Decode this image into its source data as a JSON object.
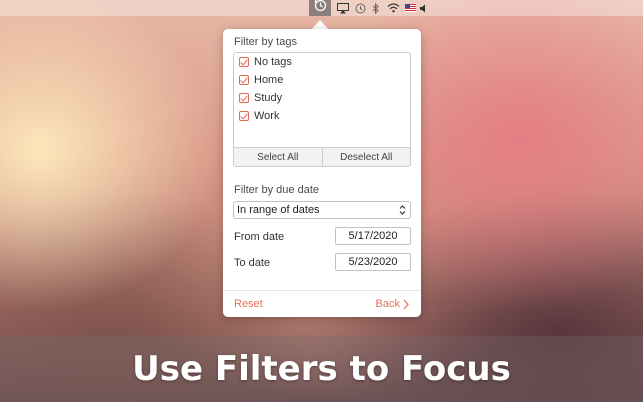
{
  "menubar": {
    "active_item_icon": "clock-countdown-icon",
    "status_icons": [
      "airplay-icon",
      "time-machine-icon",
      "bluetooth-icon",
      "wifi-icon",
      "us-flag-icon",
      "volume-icon"
    ]
  },
  "popover": {
    "tags_heading": "Filter by tags",
    "tags": [
      {
        "label": "No tags",
        "checked": true
      },
      {
        "label": "Home",
        "checked": true
      },
      {
        "label": "Study",
        "checked": true
      },
      {
        "label": "Work",
        "checked": true
      }
    ],
    "select_all_label": "Select All",
    "deselect_all_label": "Deselect All",
    "due_date_heading": "Filter by due date",
    "due_date_mode": "In range of dates",
    "from_date_label": "From date",
    "from_date_value": "5/17/2020",
    "to_date_label": "To date",
    "to_date_value": "5/23/2020",
    "reset_label": "Reset",
    "back_label": "Back"
  },
  "caption": {
    "text": "Use Filters to Focus"
  },
  "colors": {
    "accent": "#e5705c"
  }
}
